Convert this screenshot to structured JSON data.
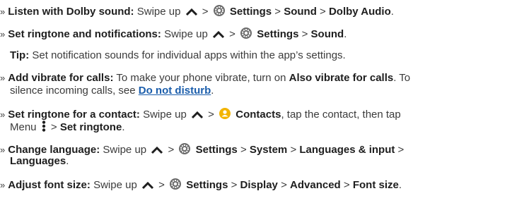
{
  "bullet": "»",
  "sep": ">",
  "colors": {
    "link": "#1a5dab",
    "settings_icon": "#6b6b6b",
    "contacts_icon": "#f2b400"
  },
  "items": [
    {
      "label": "Listen with Dolby sound:",
      "pre": "Swipe up",
      "app": "Settings",
      "path1": "Sound",
      "path2": "Dolby Audio",
      "end": "."
    },
    {
      "label": "Set ringtone and notifications:",
      "pre": "Swipe up",
      "app": "Settings",
      "path1": "Sound",
      "end": "."
    },
    {
      "tip_label": "Tip:",
      "tip_text": "Set notification sounds for individual apps within the app’s settings."
    },
    {
      "label": "Add vibrate for calls:",
      "text1": "To make your phone vibrate, turn on",
      "bold1": "Also vibrate for calls",
      "text2": ". To",
      "text3": "silence incoming calls, see",
      "link": "Do not disturb",
      "end": "."
    },
    {
      "label": "Set ringtone for a contact:",
      "pre": "Swipe up",
      "app": "Contacts",
      "text1": ", tap the contact, then tap",
      "menu": "Menu",
      "bold1": "Set ringtone",
      "end": "."
    },
    {
      "label": "Change language:",
      "pre": "Swipe up",
      "app": "Settings",
      "path1": "System",
      "path2": "Languages & input",
      "path3": "Languages",
      "end": "."
    },
    {
      "label": "Adjust font size:",
      "pre": "Swipe up",
      "app": "Settings",
      "path1": "Display",
      "path2": "Advanced",
      "path3": "Font size",
      "end": "."
    }
  ]
}
